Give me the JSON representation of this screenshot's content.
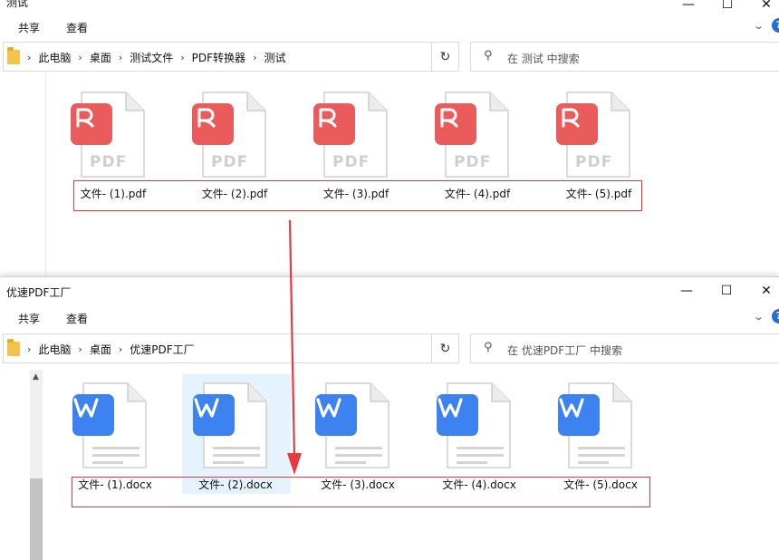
{
  "window_top": {
    "title": "测试",
    "menu": [
      "共享",
      "查看"
    ],
    "breadcrumbs": [
      "此电脑",
      "桌面",
      "测试文件",
      "PDF转换器",
      "测试"
    ],
    "search_placeholder": "在 测试 中搜索",
    "files": [
      {
        "name": "文件- (1).pdf",
        "icon": "pdf-file-icon"
      },
      {
        "name": "文件- (2).pdf",
        "icon": "pdf-file-icon"
      },
      {
        "name": "文件- (3).pdf",
        "icon": "pdf-file-icon"
      },
      {
        "name": "文件- (4).pdf",
        "icon": "pdf-file-icon"
      },
      {
        "name": "文件- (5).pdf",
        "icon": "pdf-file-icon"
      }
    ],
    "pdf_label": "PDF"
  },
  "window_bottom": {
    "title": "优速PDF工厂",
    "menu": [
      "共享",
      "查看"
    ],
    "breadcrumbs": [
      "此电脑",
      "桌面",
      "优速PDF工厂"
    ],
    "search_placeholder": "在 优速PDF工厂 中搜索",
    "files": [
      {
        "name": "文件- (1).docx",
        "icon": "word-file-icon"
      },
      {
        "name": "文件- (2).docx",
        "icon": "word-file-icon",
        "selected": true
      },
      {
        "name": "文件- (3).docx",
        "icon": "word-file-icon"
      },
      {
        "name": "文件- (4).docx",
        "icon": "word-file-icon"
      },
      {
        "name": "文件- (5).docx",
        "icon": "word-file-icon"
      }
    ]
  },
  "window_controls": {
    "minimize": "—",
    "maximize": "☐",
    "close": "✕"
  },
  "colors": {
    "pdf_badge": "#ea5b5b",
    "word_badge": "#3c82f0",
    "highlight_box": "#e0393e",
    "selection": "#e5f3ff"
  }
}
